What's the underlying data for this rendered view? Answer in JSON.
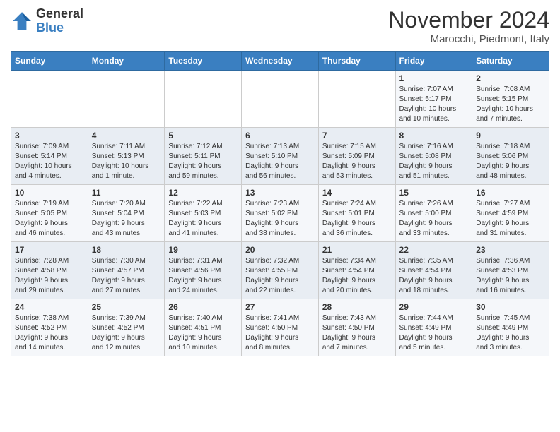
{
  "header": {
    "logo_general": "General",
    "logo_blue": "Blue",
    "month_year": "November 2024",
    "location": "Marocchi, Piedmont, Italy"
  },
  "weekdays": [
    "Sunday",
    "Monday",
    "Tuesday",
    "Wednesday",
    "Thursday",
    "Friday",
    "Saturday"
  ],
  "weeks": [
    [
      {
        "day": "",
        "info": ""
      },
      {
        "day": "",
        "info": ""
      },
      {
        "day": "",
        "info": ""
      },
      {
        "day": "",
        "info": ""
      },
      {
        "day": "",
        "info": ""
      },
      {
        "day": "1",
        "info": "Sunrise: 7:07 AM\nSunset: 5:17 PM\nDaylight: 10 hours\nand 10 minutes."
      },
      {
        "day": "2",
        "info": "Sunrise: 7:08 AM\nSunset: 5:15 PM\nDaylight: 10 hours\nand 7 minutes."
      }
    ],
    [
      {
        "day": "3",
        "info": "Sunrise: 7:09 AM\nSunset: 5:14 PM\nDaylight: 10 hours\nand 4 minutes."
      },
      {
        "day": "4",
        "info": "Sunrise: 7:11 AM\nSunset: 5:13 PM\nDaylight: 10 hours\nand 1 minute."
      },
      {
        "day": "5",
        "info": "Sunrise: 7:12 AM\nSunset: 5:11 PM\nDaylight: 9 hours\nand 59 minutes."
      },
      {
        "day": "6",
        "info": "Sunrise: 7:13 AM\nSunset: 5:10 PM\nDaylight: 9 hours\nand 56 minutes."
      },
      {
        "day": "7",
        "info": "Sunrise: 7:15 AM\nSunset: 5:09 PM\nDaylight: 9 hours\nand 53 minutes."
      },
      {
        "day": "8",
        "info": "Sunrise: 7:16 AM\nSunset: 5:08 PM\nDaylight: 9 hours\nand 51 minutes."
      },
      {
        "day": "9",
        "info": "Sunrise: 7:18 AM\nSunset: 5:06 PM\nDaylight: 9 hours\nand 48 minutes."
      }
    ],
    [
      {
        "day": "10",
        "info": "Sunrise: 7:19 AM\nSunset: 5:05 PM\nDaylight: 9 hours\nand 46 minutes."
      },
      {
        "day": "11",
        "info": "Sunrise: 7:20 AM\nSunset: 5:04 PM\nDaylight: 9 hours\nand 43 minutes."
      },
      {
        "day": "12",
        "info": "Sunrise: 7:22 AM\nSunset: 5:03 PM\nDaylight: 9 hours\nand 41 minutes."
      },
      {
        "day": "13",
        "info": "Sunrise: 7:23 AM\nSunset: 5:02 PM\nDaylight: 9 hours\nand 38 minutes."
      },
      {
        "day": "14",
        "info": "Sunrise: 7:24 AM\nSunset: 5:01 PM\nDaylight: 9 hours\nand 36 minutes."
      },
      {
        "day": "15",
        "info": "Sunrise: 7:26 AM\nSunset: 5:00 PM\nDaylight: 9 hours\nand 33 minutes."
      },
      {
        "day": "16",
        "info": "Sunrise: 7:27 AM\nSunset: 4:59 PM\nDaylight: 9 hours\nand 31 minutes."
      }
    ],
    [
      {
        "day": "17",
        "info": "Sunrise: 7:28 AM\nSunset: 4:58 PM\nDaylight: 9 hours\nand 29 minutes."
      },
      {
        "day": "18",
        "info": "Sunrise: 7:30 AM\nSunset: 4:57 PM\nDaylight: 9 hours\nand 27 minutes."
      },
      {
        "day": "19",
        "info": "Sunrise: 7:31 AM\nSunset: 4:56 PM\nDaylight: 9 hours\nand 24 minutes."
      },
      {
        "day": "20",
        "info": "Sunrise: 7:32 AM\nSunset: 4:55 PM\nDaylight: 9 hours\nand 22 minutes."
      },
      {
        "day": "21",
        "info": "Sunrise: 7:34 AM\nSunset: 4:54 PM\nDaylight: 9 hours\nand 20 minutes."
      },
      {
        "day": "22",
        "info": "Sunrise: 7:35 AM\nSunset: 4:54 PM\nDaylight: 9 hours\nand 18 minutes."
      },
      {
        "day": "23",
        "info": "Sunrise: 7:36 AM\nSunset: 4:53 PM\nDaylight: 9 hours\nand 16 minutes."
      }
    ],
    [
      {
        "day": "24",
        "info": "Sunrise: 7:38 AM\nSunset: 4:52 PM\nDaylight: 9 hours\nand 14 minutes."
      },
      {
        "day": "25",
        "info": "Sunrise: 7:39 AM\nSunset: 4:52 PM\nDaylight: 9 hours\nand 12 minutes."
      },
      {
        "day": "26",
        "info": "Sunrise: 7:40 AM\nSunset: 4:51 PM\nDaylight: 9 hours\nand 10 minutes."
      },
      {
        "day": "27",
        "info": "Sunrise: 7:41 AM\nSunset: 4:50 PM\nDaylight: 9 hours\nand 8 minutes."
      },
      {
        "day": "28",
        "info": "Sunrise: 7:43 AM\nSunset: 4:50 PM\nDaylight: 9 hours\nand 7 minutes."
      },
      {
        "day": "29",
        "info": "Sunrise: 7:44 AM\nSunset: 4:49 PM\nDaylight: 9 hours\nand 5 minutes."
      },
      {
        "day": "30",
        "info": "Sunrise: 7:45 AM\nSunset: 4:49 PM\nDaylight: 9 hours\nand 3 minutes."
      }
    ]
  ]
}
